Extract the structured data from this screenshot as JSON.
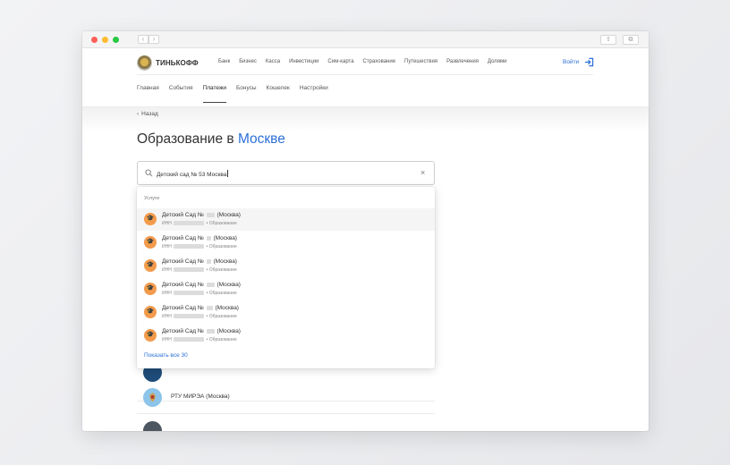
{
  "browser": {
    "back": "‹",
    "forward": "›",
    "share": "⇧",
    "tabs": "⧉"
  },
  "header": {
    "logo_text": "ТИНЬКОФФ",
    "menu": [
      "Банк",
      "Бизнес",
      "Касса",
      "Инвестиции",
      "Сим-карта",
      "Страхование",
      "Путешествия",
      "Развлечения",
      "Долями"
    ],
    "login_label": "Войти",
    "tabs": [
      "Главная",
      "События",
      "Платежи",
      "Бонусы",
      "Кошелек",
      "Настройки"
    ],
    "active_tab": "Платежи"
  },
  "page": {
    "back_label": "Назад",
    "title_prefix": "Образование в",
    "title_city": "Москве"
  },
  "search": {
    "value": "Детский сад № 53 Москва",
    "clear": "×"
  },
  "dropdown": {
    "heading": "Услуги",
    "items": [
      {
        "title_prefix": "Детский Сад №",
        "title_suffix": "(Москва)",
        "inn": "ИНН",
        "category": "• Образование"
      },
      {
        "title_prefix": "Детский Сад №",
        "title_suffix": "(Москва)",
        "inn": "ИНН",
        "category": "• Образование"
      },
      {
        "title_prefix": "Детский Сад №",
        "title_suffix": "(Москва)",
        "inn": "ИНН",
        "category": "• Образование"
      },
      {
        "title_prefix": "Детский Сад №",
        "title_suffix": "(Москва)",
        "inn": "ИНН",
        "category": "• Образование"
      },
      {
        "title_prefix": "Детский Сад №",
        "title_suffix": "(Москва)",
        "inn": "ИНН",
        "category": "• Образование"
      },
      {
        "title_prefix": "Детский Сад №",
        "title_suffix": "(Москва)",
        "inn": "ИНН",
        "category": "• Образование"
      }
    ],
    "show_all": "Показать все 30"
  },
  "results": [
    {
      "title": "",
      "avatar_color": "#1f4c7a"
    },
    {
      "title": "РТУ МИРЭА (Москва)",
      "avatar_color": "#8cc4ea"
    },
    {
      "title": "",
      "avatar_color": "#4d5660"
    }
  ],
  "colors": {
    "accent": "#2b6fd6",
    "item_icon": "#f39a4c"
  }
}
